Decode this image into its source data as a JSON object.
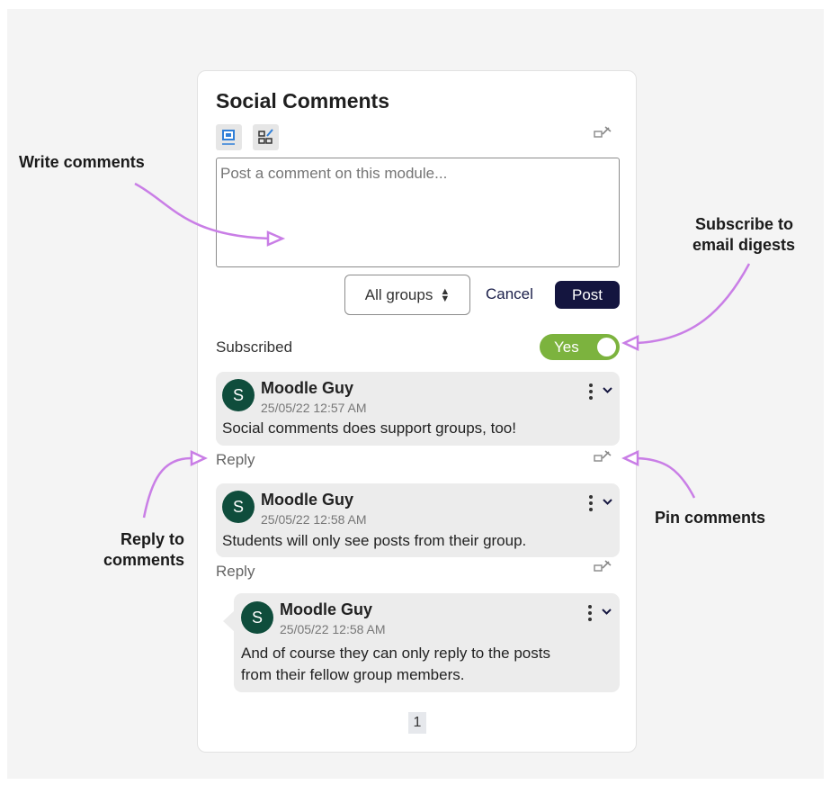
{
  "annotations": {
    "write": "Write comments",
    "subscribe_line1": "Subscribe to",
    "subscribe_line2": "email digests",
    "reply_line1": "Reply to",
    "reply_line2": "comments",
    "pin": "Pin comments"
  },
  "card": {
    "title": "Social Comments",
    "textarea_placeholder": "Post a comment on this module...",
    "groups_select": "All groups",
    "cancel_label": "Cancel",
    "post_label": "Post",
    "subscribed_label": "Subscribed",
    "toggle_label": "Yes",
    "subscribed_on": true
  },
  "comments": [
    {
      "avatar": "S",
      "author": "Moodle Guy",
      "date": "25/05/22 12:57 AM",
      "body": "Social comments does support groups, too!",
      "reply_label": "Reply"
    },
    {
      "avatar": "S",
      "author": "Moodle Guy",
      "date": "25/05/22 12:58 AM",
      "body": "Students will only see posts from their group.",
      "reply_label": "Reply"
    },
    {
      "avatar": "S",
      "author": "Moodle Guy",
      "date": "25/05/22 12:58 AM",
      "body_line1": "And of course they can only reply to the posts",
      "body_line2": "from their fellow group members."
    }
  ],
  "pagination": {
    "current": "1"
  },
  "colors": {
    "annotation_arrow": "#c97ee6",
    "post_button": "#14153f",
    "toggle_on": "#7cb33e",
    "avatar": "#0f4d3c",
    "comment_bg": "#ececec"
  },
  "icons": [
    "compose-icon",
    "layout-pin-icon",
    "pin-icon",
    "kebab-icon",
    "chevron-down-icon",
    "select-caret-icon"
  ]
}
